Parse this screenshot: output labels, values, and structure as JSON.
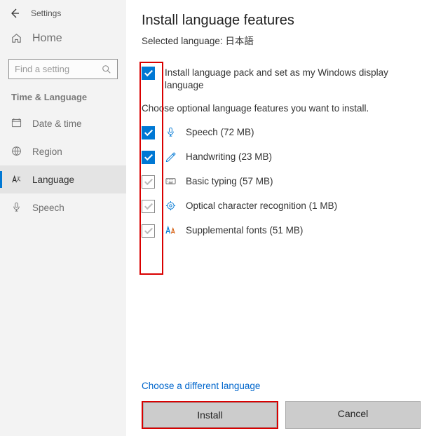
{
  "sidebar": {
    "title": "Settings",
    "home": "Home",
    "search_placeholder": "Find a setting",
    "heading": "Time & Language",
    "items": [
      {
        "label": "Date & time"
      },
      {
        "label": "Region"
      },
      {
        "label": "Language"
      },
      {
        "label": "Speech"
      }
    ]
  },
  "main": {
    "title": "Install language features",
    "subtitle": "Selected language: 日本語",
    "install_pack_label": "Install language pack and set as my Windows display language",
    "optional_text": "Choose optional language features you want to install.",
    "features": [
      {
        "label": "Speech (72 MB)"
      },
      {
        "label": "Handwriting (23 MB)"
      },
      {
        "label": "Basic typing (57 MB)"
      },
      {
        "label": "Optical character recognition (1 MB)"
      },
      {
        "label": "Supplemental fonts (51 MB)"
      }
    ],
    "choose_diff": "Choose a different language",
    "install_btn": "Install",
    "cancel_btn": "Cancel"
  }
}
